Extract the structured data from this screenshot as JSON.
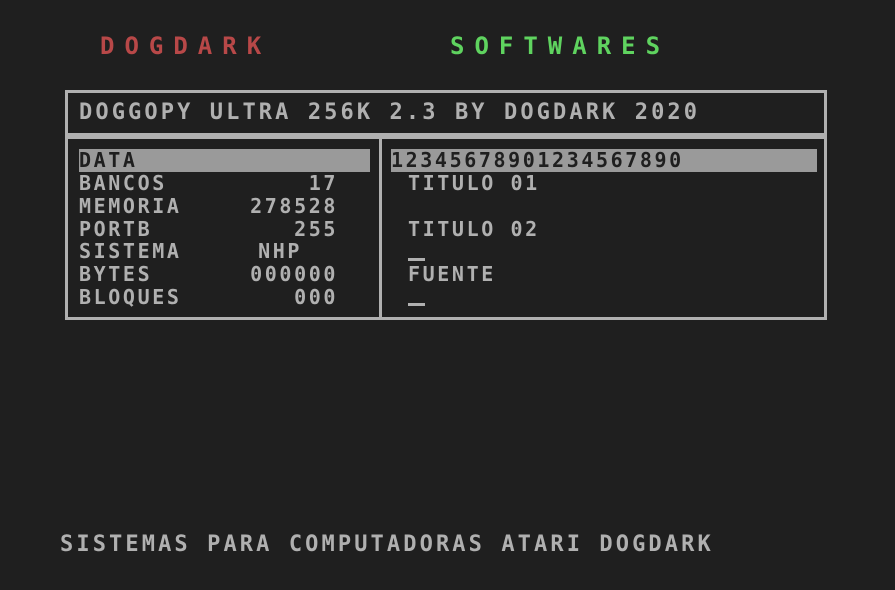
{
  "header": {
    "brand_left": "DOGDARK",
    "brand_right": "SOFTWARES",
    "brand_left_color": "#b84848",
    "brand_right_color": "#5fd35f"
  },
  "title_bar": {
    "text": "DOGGOPY ULTRA 256K 2.3 BY DOGDARK 2020"
  },
  "info_panel": {
    "selected_label": "DATA",
    "rows": [
      {
        "label": "BANCOS",
        "value": "17"
      },
      {
        "label": "MEMORIA",
        "value": "278528"
      },
      {
        "label": "PORTB",
        "value": "255"
      },
      {
        "label": "SISTEMA",
        "value": "NHP"
      },
      {
        "label": "BYTES",
        "value": "000000"
      },
      {
        "label": "BLOQUES",
        "value": "000"
      }
    ]
  },
  "edit_panel": {
    "ruler": "12345678901234567890",
    "title1": "TITULO 01",
    "title2": "TITULO 02",
    "source": "FUENTE"
  },
  "footer": {
    "text": "SISTEMAS PARA COMPUTADORAS ATARI DOGDARK"
  },
  "colors": {
    "background": "#1f1f1f",
    "foreground": "#b0b0b0",
    "highlight": "#9a9a9a"
  }
}
